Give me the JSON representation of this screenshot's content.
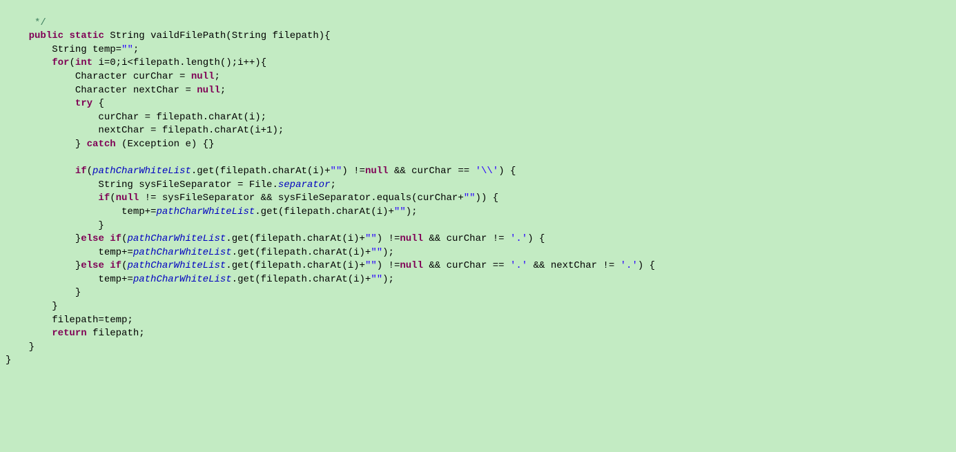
{
  "kw": {
    "public": "public",
    "static": "static",
    "for": "for",
    "int": "int",
    "null": "null",
    "try": "try",
    "catch": "catch",
    "if": "if",
    "else": "else",
    "return": "return"
  },
  "fi": {
    "pcwl": "pathCharWhiteList",
    "sep": "separator"
  },
  "str": {
    "es": "\"\"",
    "bs": "'\\\\'",
    "dot": "'.'"
  },
  "lines": {
    "0": "     */",
    "1a": "String vaildFilePath(String filepath){",
    "2a": "String temp=",
    "2b": ";",
    "3a": "(",
    "3b": " i=0;i<filepath.length();i++){",
    "4a": "Character curChar = ",
    "4b": ";",
    "5a": "Character nextChar = ",
    "5b": ";",
    "6a": " {",
    "7a": "curChar = filepath.charAt(i);",
    "8a": "nextChar = filepath.charAt(i+1);",
    "9a": "} ",
    "9b": " (Exception e) {}",
    "11a": "(",
    "11b": ".get(filepath.charAt(i)+",
    "11c": ") !=",
    "11d": " && curChar == ",
    "11e": ") {",
    "12a": "String sysFileSeparator = File.",
    "12b": ";",
    "13a": "(",
    "13b": " != sysFileSeparator && sysFileSeparator.equals(curChar+",
    "13c": ")) {",
    "14a": "temp+=",
    "14b": ".get(filepath.charAt(i)+",
    "14c": ");",
    "15a": "}",
    "16a": "}",
    "16b": "(",
    "16c": ".get(filepath.charAt(i)+",
    "16d": ") !=",
    "16e": " && curChar != ",
    "16f": ") {",
    "17a": "temp+=",
    "17b": ".get(filepath.charAt(i)+",
    "17c": ");",
    "18a": "}",
    "18b": "(",
    "18c": ".get(filepath.charAt(i)+",
    "18d": ") !=",
    "18e": " && curChar == ",
    "18f": " && nextChar != ",
    "18g": ") {",
    "19a": "temp+=",
    "19b": ".get(filepath.charAt(i)+",
    "19c": ");",
    "20a": "}",
    "21a": "}",
    "22a": "filepath=temp;",
    "23a": " filepath;",
    "24a": "}",
    "25a": "}"
  }
}
